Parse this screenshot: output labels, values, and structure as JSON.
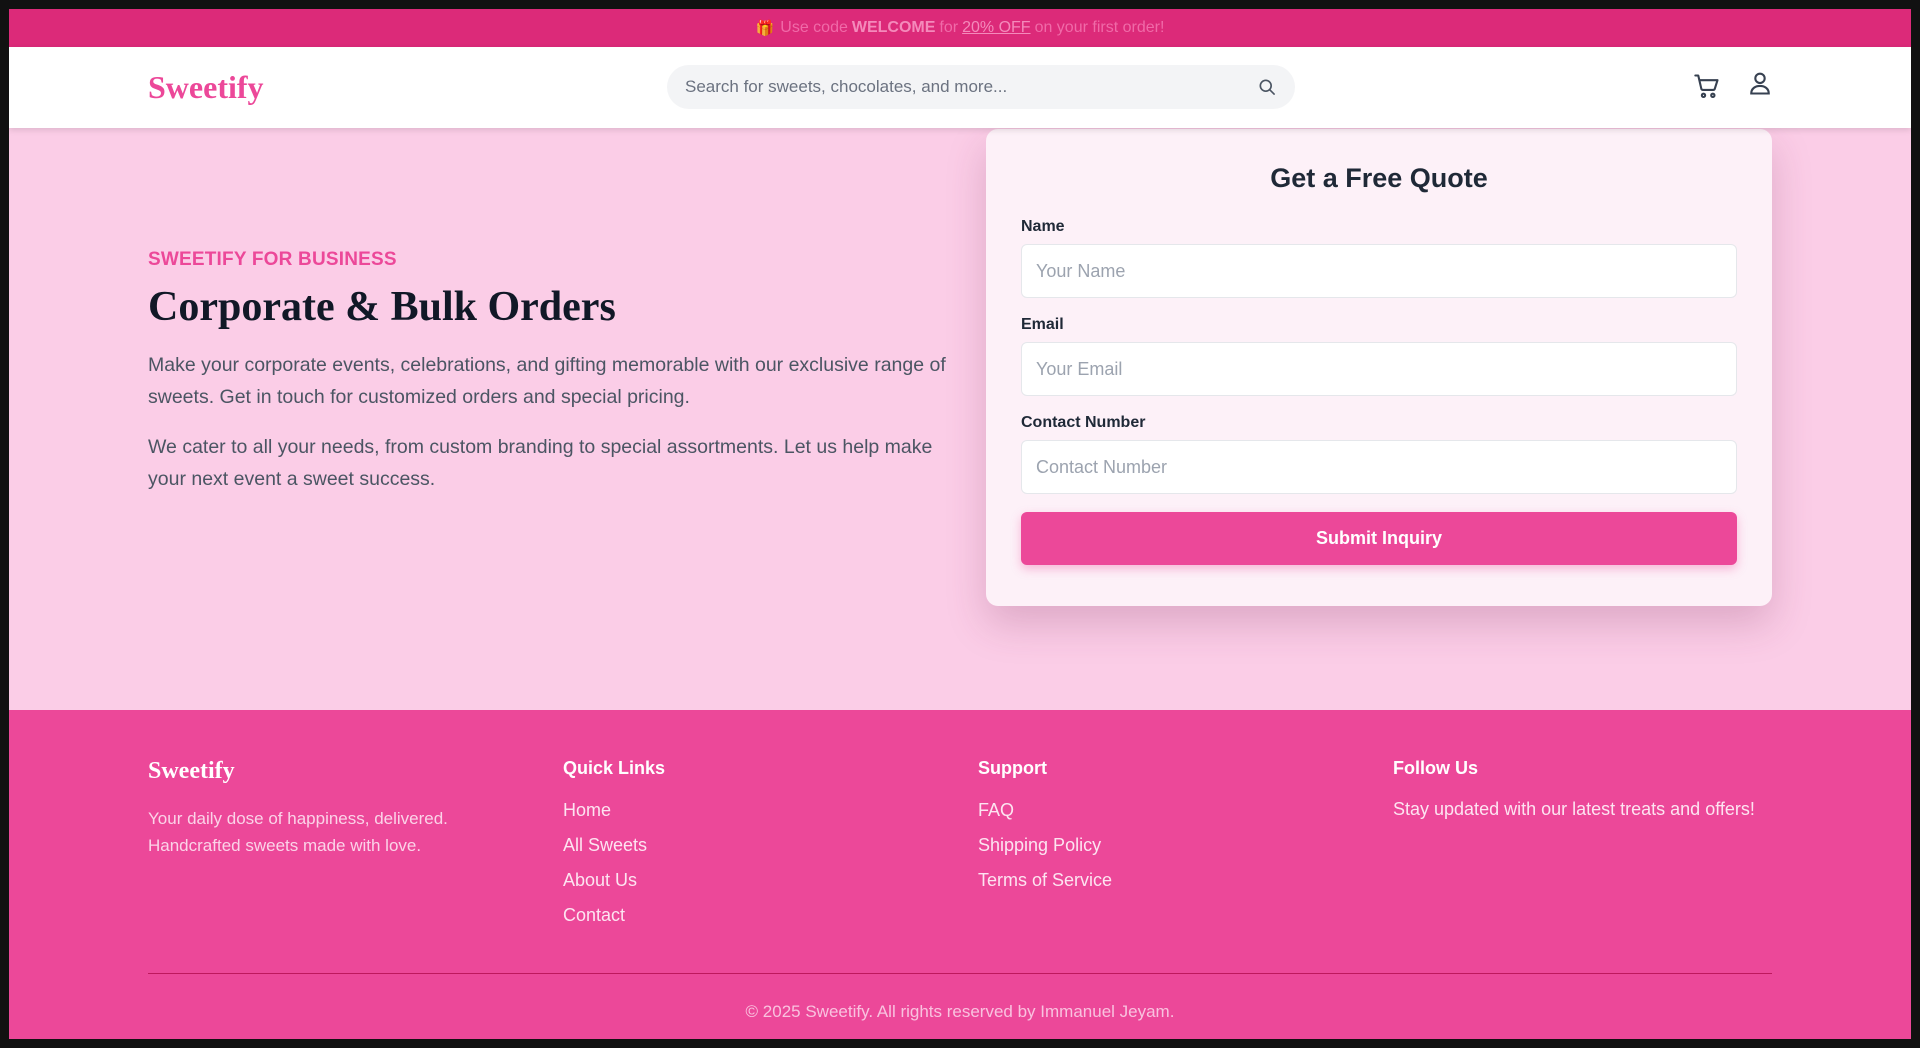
{
  "promo": {
    "gift_icon": "gift-icon",
    "prefix": "Use code",
    "code": "WELCOME",
    "middle": "for",
    "discount": "20% OFF",
    "suffix": "on your first order!"
  },
  "header": {
    "logo": "Sweetify",
    "search_placeholder": "Search for sweets, chocolates, and more...",
    "icons": [
      "search-icon",
      "cart-icon",
      "user-icon"
    ]
  },
  "hero": {
    "eyebrow": "SWEETIFY FOR BUSINESS",
    "title": "Corporate & Bulk Orders",
    "paragraph1": "Make your corporate events, celebrations, and gifting memorable with our exclusive range of sweets. Get in touch for customized orders and special pricing.",
    "paragraph2": "We cater to all your needs, from custom branding to special assortments. Let us help make your next event a sweet success."
  },
  "quote_form": {
    "title": "Get a Free Quote",
    "name_label": "Name",
    "name_placeholder": "Your Name",
    "email_label": "Email",
    "email_placeholder": "Your Email",
    "phone_label": "Contact Number",
    "phone_placeholder": "Contact Number",
    "submit_label": "Submit Inquiry"
  },
  "footer": {
    "brand": "Sweetify",
    "tagline": "Your daily dose of happiness, delivered. Handcrafted sweets made with love.",
    "quick_links": {
      "heading": "Quick Links",
      "items": [
        "Home",
        "All Sweets",
        "About Us",
        "Contact"
      ]
    },
    "support": {
      "heading": "Support",
      "items": [
        "FAQ",
        "Shipping Policy",
        "Terms of Service"
      ]
    },
    "follow": {
      "heading": "Follow Us",
      "text": "Stay updated with our latest treats and offers!"
    },
    "copyright": "© 2025 Sweetify. All rights reserved by Immanuel Jeyam."
  },
  "colors": {
    "brand_pink": "#ec4899",
    "promo_bar": "#dc2a79",
    "hero_bg": "#fbcde7",
    "card_bg": "#fdf1f8",
    "heading_dark": "#111827"
  }
}
